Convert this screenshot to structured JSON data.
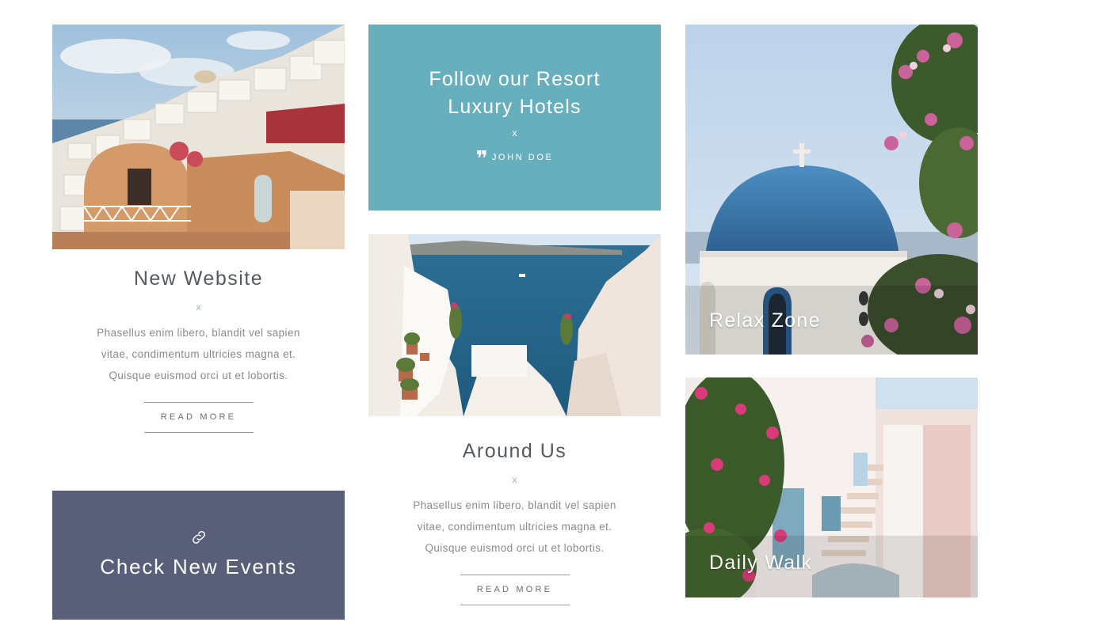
{
  "posts": [
    {
      "title": "New Website",
      "divider": "x",
      "excerpt_lines": [
        "Phasellus enim libero, blandit vel sapien",
        "vitae, condimentum ultricies magna et.",
        "Quisque euismod orci ut et lobortis."
      ],
      "read_more": "READ MORE"
    },
    {
      "title": "Around Us",
      "divider": "x",
      "excerpt_lines": [
        "Phasellus enim libero, blandit vel sapien",
        "vitae, condimentum ultricies magna et.",
        "Quisque euismod orci ut et lobortis."
      ],
      "read_more": "READ MORE"
    }
  ],
  "quote": {
    "line1": "Follow our Resort",
    "line2": "Luxury Hotels",
    "divider": "x",
    "author": "JOHN DOE",
    "icon": "quote-icon"
  },
  "event": {
    "title": "Check New Events",
    "icon": "link-icon"
  },
  "tiles": [
    {
      "title": "Relax Zone"
    },
    {
      "title": "Daily Walk"
    }
  ],
  "colors": {
    "teal": "#67afbd",
    "slate": "#595f79",
    "divider_accent": "#8fb9c1"
  }
}
